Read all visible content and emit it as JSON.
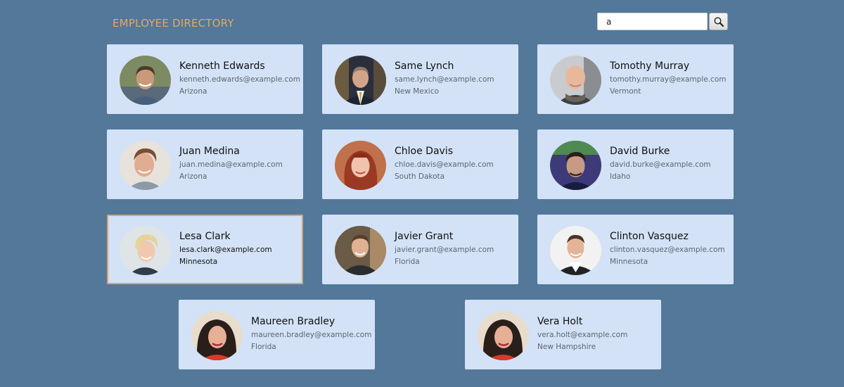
{
  "header": {
    "title": "EMPLOYEE DIRECTORY"
  },
  "search": {
    "value": "a",
    "button_icon": "search-icon"
  },
  "colors": {
    "background": "#53789a",
    "title": "#e2a866",
    "card": "#d3e2f6",
    "selected_border": "#dca46c"
  },
  "employees": [
    {
      "name": "Kenneth Edwards",
      "email": "kenneth.edwards@example.com",
      "state": "Arizona"
    },
    {
      "name": "Same Lynch",
      "email": "same.lynch@example.com",
      "state": "New Mexico"
    },
    {
      "name": "Tomothy Murray",
      "email": "tomothy.murray@example.com",
      "state": "Vermont"
    },
    {
      "name": "Juan Medina",
      "email": "juan.medina@example.com",
      "state": "Arizona"
    },
    {
      "name": "Chloe Davis",
      "email": "chloe.davis@example.com",
      "state": "South Dakota"
    },
    {
      "name": "David Burke",
      "email": "david.burke@example.com",
      "state": "Idaho"
    },
    {
      "name": "Lesa Clark",
      "email": "lesa.clark@example.com",
      "state": "Minnesota",
      "selected": true
    },
    {
      "name": "Javier Grant",
      "email": "javier.grant@example.com",
      "state": "Florida"
    },
    {
      "name": "Clinton Vasquez",
      "email": "clinton.vasquez@example.com",
      "state": "Minnesota"
    },
    {
      "name": "Maureen Bradley",
      "email": "maureen.bradley@example.com",
      "state": "Florida"
    },
    {
      "name": "Vera Holt",
      "email": "vera.holt@example.com",
      "state": "New Hampshire"
    }
  ]
}
